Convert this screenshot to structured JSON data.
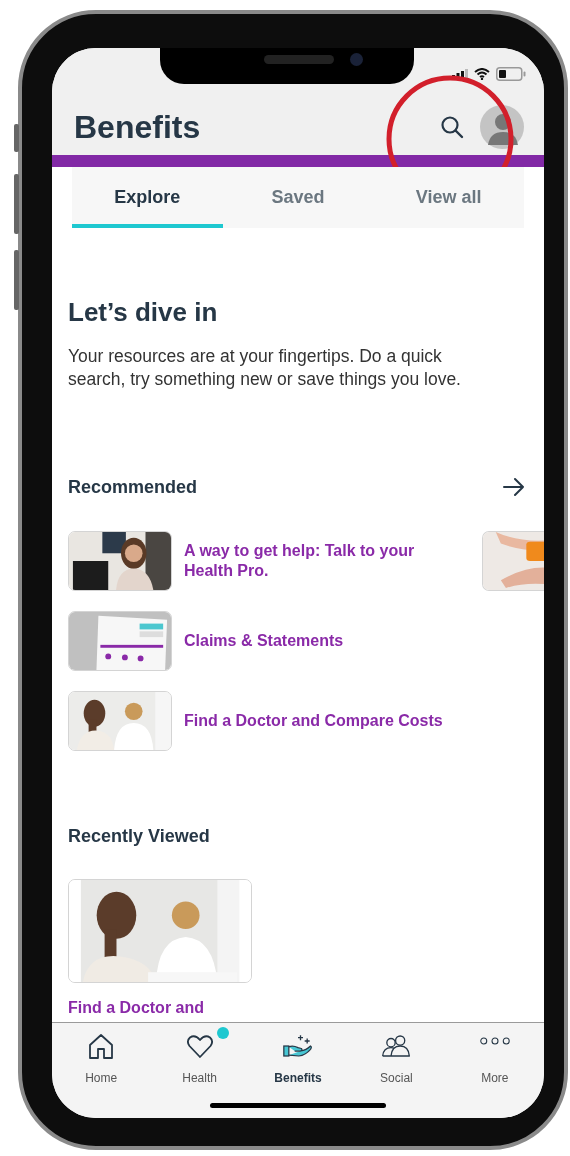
{
  "header": {
    "title": "Benefits"
  },
  "tabs": [
    {
      "label": "Explore",
      "selected": true
    },
    {
      "label": "Saved",
      "selected": false
    },
    {
      "label": "View all",
      "selected": false
    }
  ],
  "intro": {
    "heading": "Let’s dive in",
    "text": "Your resources are at your fingertips. Do a quick search, try something new or save things you love."
  },
  "recommended": {
    "title": "Recommended",
    "items": [
      {
        "title": "A way to get help: Talk to your Health Pro.",
        "kind": "picture"
      },
      {
        "title": "Claims & Statements",
        "kind": "picture"
      },
      {
        "title": "Find a Doctor and Compare Costs",
        "kind": "picture"
      }
    ]
  },
  "recently_viewed": {
    "title": "Recently Viewed",
    "items": [
      {
        "title": "Find a Doctor and",
        "kind": "picture"
      }
    ]
  },
  "bottom_nav": [
    {
      "label": "Home",
      "selected": false,
      "badge": false
    },
    {
      "label": "Health",
      "selected": false,
      "badge": true
    },
    {
      "label": "Benefits",
      "selected": true,
      "badge": false
    },
    {
      "label": "Social",
      "selected": false,
      "badge": false
    },
    {
      "label": "More",
      "selected": false,
      "badge": false
    }
  ]
}
